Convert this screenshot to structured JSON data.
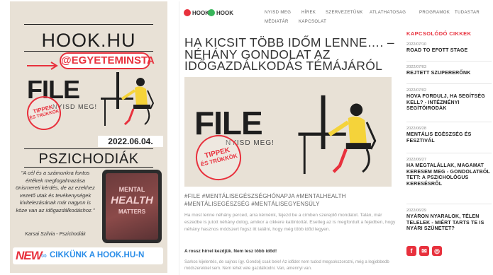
{
  "story": {
    "brand": "HOOK.HU",
    "handle": "@EGYETEMINSTA",
    "file_logo": "FILE",
    "file_sub": "NYISD MEG!",
    "stamp_line1": "TIPPEK",
    "stamp_line2": "ÉS TRÜKKÖK",
    "date": "2022.06.04.",
    "section": "PSZICHODIÁK",
    "quote": "\"A cél és a számunkra fontos értékek megfogalmazása önismereti kérdés, de az ezekhez vezető utak és tevékenységek kivitelezásának már nagyon is köze van az időgazdálkodáshoz.\"",
    "author": "Karsai Szilvia - Pszichodiák",
    "tablet_line1": "MENTAL",
    "tablet_line2": "HEALTH",
    "tablet_line3": "MATTERS",
    "new_tag": "NEW",
    "cta": "CIKKÜNK A HOOK.HU-N"
  },
  "web": {
    "logos": [
      "HOOK",
      "HOOK"
    ],
    "nav_row1": [
      "NYISD MEG",
      "HÍREK",
      "SZERVEZETÜNK",
      "ATLATHATOSAG",
      "PROGRAMOK",
      "TUDASTAR"
    ],
    "nav_row2": [
      "MÉDIATÁR",
      "KAPCSOLAT"
    ],
    "title": "HA KICSIT TÖBB IDŐM LENNE…. – NÉHÁNY GONDOLAT AZ IDŐGAZDÁLKODÁS TÉMÁJÁRÓL",
    "hero_file": "FILE",
    "hero_sub": "NYISD MEG!",
    "hero_stamp1": "TIPPEK",
    "hero_stamp2": "ÉS TRÜKKÖK",
    "tags": "#FILE #MENTÁLISEGÉSZSÉGHÓNAPJA #MENTALHEALTH #MENTÁLISEGÉSZSÉG #MENTÁLISEGYENSÚLY",
    "lead": "Ha most lenne néhány perced, arra kérnénk, fejezd be a címben szereplő mondatot. Talán, már eszedbe is jutott néhány dolog, amikor a cikkere kattintottál. Esetleg az is megfordult a fejedben, hogy néhány hasznos módszert fogsz itt találni, hogy még több időd legyen.",
    "subhead": "A rossz hírrel kezdjük. Nem lesz több időd!",
    "para": "Sarkos kijelentés, de sajnos így. Gondolj csak bele! Az idődet nem tudod megsokszorozni, még a legjobbedb módszerekkel sem. Nem lehet vele gazdálkodni. Van, amennyi van."
  },
  "related": {
    "heading": "KAPCSOLÓDÓ CIKKEK",
    "items": [
      {
        "date": "2022/07/10",
        "title": "ROAD TO EFOTT STAGE"
      },
      {
        "date": "2022/07/03",
        "title": "REJTETT SZUPERERŐNK"
      },
      {
        "date": "2022/07/02",
        "title": "HOVA FORDULJ, HA SEGÍTSÉG KELL? - INTÉZMÉNYI SEGÍTŐIRODÁK"
      },
      {
        "date": "2022/06/28",
        "title": "MENTÁLIS EGÉSZSÉG ÉS FESZTIVÁL"
      },
      {
        "date": "2022/06/27",
        "title": "HA MEGTALÁLLAK, MAGAMAT KERESEM MEG - GONDOLATBÓL TETT: A PSZICHOLÓGUS KERESÉSRŐL"
      },
      {
        "date": "2022/06/29",
        "title": "NYÁRON NYARALOK, TÉLEN TELELEK - MIÉRT TARTS TE IS NYÁRI SZÜNETET?"
      }
    ]
  },
  "social": [
    "f",
    "✉",
    "◎"
  ],
  "colors": {
    "accent": "#e8313d",
    "story_bg": "#e8e1d6",
    "cta": "#2a8de8",
    "shirt": "#f5d33a"
  }
}
